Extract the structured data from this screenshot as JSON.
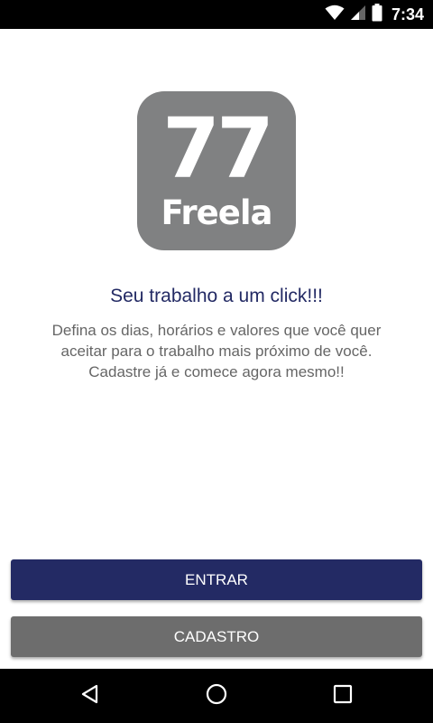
{
  "status_bar": {
    "time": "7:34",
    "icons": [
      "wifi-icon",
      "signal-icon",
      "battery-icon"
    ]
  },
  "logo": {
    "number": "77",
    "word": "Freela"
  },
  "headline": "Seu trabalho a um click!!!",
  "description": [
    "Defina os dias, horários e valores que você quer",
    "aceitar para o trabalho mais próximo de você.",
    "Cadastre já e comece agora mesmo!!"
  ],
  "buttons": {
    "login": "ENTRAR",
    "register": "CADASTRO"
  },
  "nav_bar": {
    "icons": [
      "back-icon",
      "home-icon",
      "recents-icon"
    ]
  },
  "colors": {
    "primary": "#232a64",
    "secondary_button": "#6d6d6d",
    "logo_background": "#808182",
    "body_text": "#666666"
  }
}
